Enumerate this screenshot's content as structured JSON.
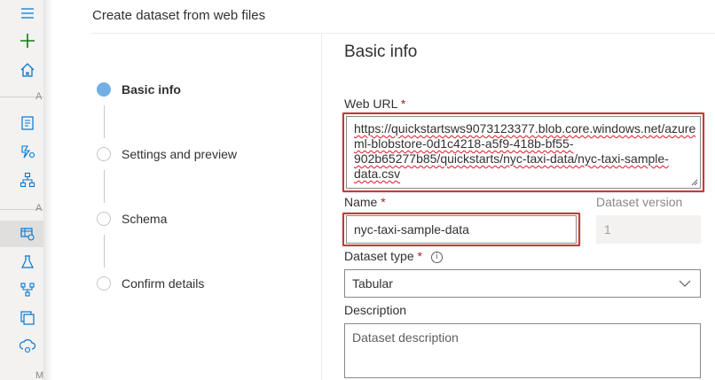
{
  "header": {
    "title": "Create dataset from web files"
  },
  "rail": {
    "items": [
      {
        "icon": "hamburger-icon"
      },
      {
        "icon": "plus-icon"
      },
      {
        "icon": "home-icon"
      },
      {
        "icon": "notebook-icon"
      },
      {
        "icon": "automl-icon"
      },
      {
        "icon": "designer-icon"
      },
      {
        "icon": "datasets-icon"
      },
      {
        "icon": "experiments-icon"
      },
      {
        "icon": "pipelines-icon"
      },
      {
        "icon": "models-icon"
      },
      {
        "icon": "endpoints-icon"
      }
    ],
    "section_letters": [
      "A",
      "A",
      "M"
    ],
    "colors": {
      "add": "#107c10",
      "icon": "#0078d4"
    }
  },
  "steps": [
    {
      "label": "Basic info",
      "active": true
    },
    {
      "label": "Settings and preview",
      "active": false
    },
    {
      "label": "Schema",
      "active": false
    },
    {
      "label": "Confirm details",
      "active": false
    }
  ],
  "form": {
    "section_title": "Basic info",
    "web_url": {
      "label": "Web URL",
      "required_mark": "*",
      "value_lines": [
        "https://quickstartsws9073123377.blob.core.windows.net/azure",
        "ml-blobstore-0d1c4218-a5f9-418b-bf55-",
        "902b65277b85/quickstarts/nyc-taxi-data/nyc-taxi-sample-",
        "data.csv"
      ]
    },
    "name": {
      "label": "Name",
      "required_mark": "*",
      "value": "nyc-taxi-sample-data"
    },
    "dataset_version": {
      "label": "Dataset version",
      "value": "1"
    },
    "dataset_type": {
      "label": "Dataset type",
      "required_mark": "*",
      "value": "Tabular",
      "info_glyph": "i"
    },
    "description": {
      "label": "Description",
      "placeholder": "Dataset description"
    }
  },
  "colors": {
    "highlight": "#d13438",
    "step_active": "#71afe5",
    "required": "#a4262c"
  }
}
